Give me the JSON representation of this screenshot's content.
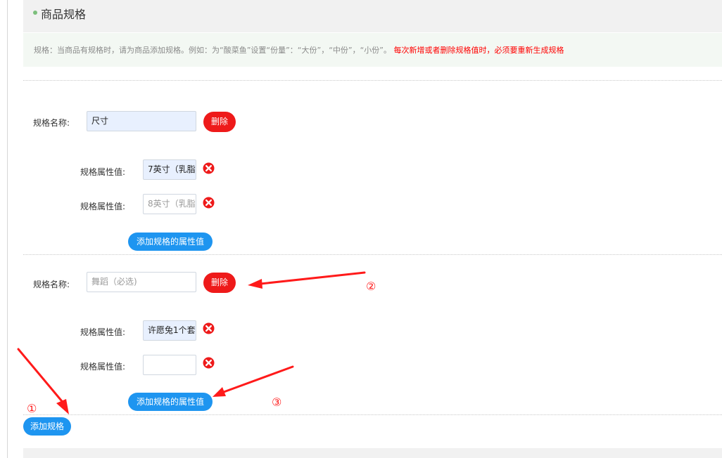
{
  "section": {
    "title": "商品规格"
  },
  "hint": {
    "text": "规格：当商品有规格时，请为商品添加规格。例如：为“酸菜鱼”设置“份量”：“大份”，“中份”，“小份”。",
    "warning": "每次新增或者删除规格值时，必须要重新生成规格"
  },
  "specs": [
    {
      "name_label": "规格名称:",
      "name_value": "尺寸",
      "delete_label": "删除",
      "attributes": [
        {
          "label": "规格属性值:",
          "value": "7英寸（乳脂",
          "placeholder": ""
        },
        {
          "label": "规格属性值:",
          "value": "",
          "placeholder": "8英寸（乳脂"
        }
      ],
      "add_attr_label": "添加规格的属性值"
    },
    {
      "name_label": "规格名称:",
      "name_value": "",
      "name_placeholder": "舞蹈（必选)",
      "delete_label": "删除",
      "attributes": [
        {
          "label": "规格属性值:",
          "value": "许愿兔1个套",
          "placeholder": ""
        },
        {
          "label": "规格属性值:",
          "value": "",
          "placeholder": ""
        }
      ],
      "add_attr_label": "添加规格的属性值"
    }
  ],
  "add_spec_label": "添加规格",
  "annotations": {
    "n1": "①",
    "n2": "②",
    "n3": "③"
  },
  "colors": {
    "delete": "#ee1a1a",
    "primary": "#1e95f0",
    "annotation": "#ff1a1a"
  },
  "icons": {
    "remove_attr": "close-circle-icon"
  }
}
